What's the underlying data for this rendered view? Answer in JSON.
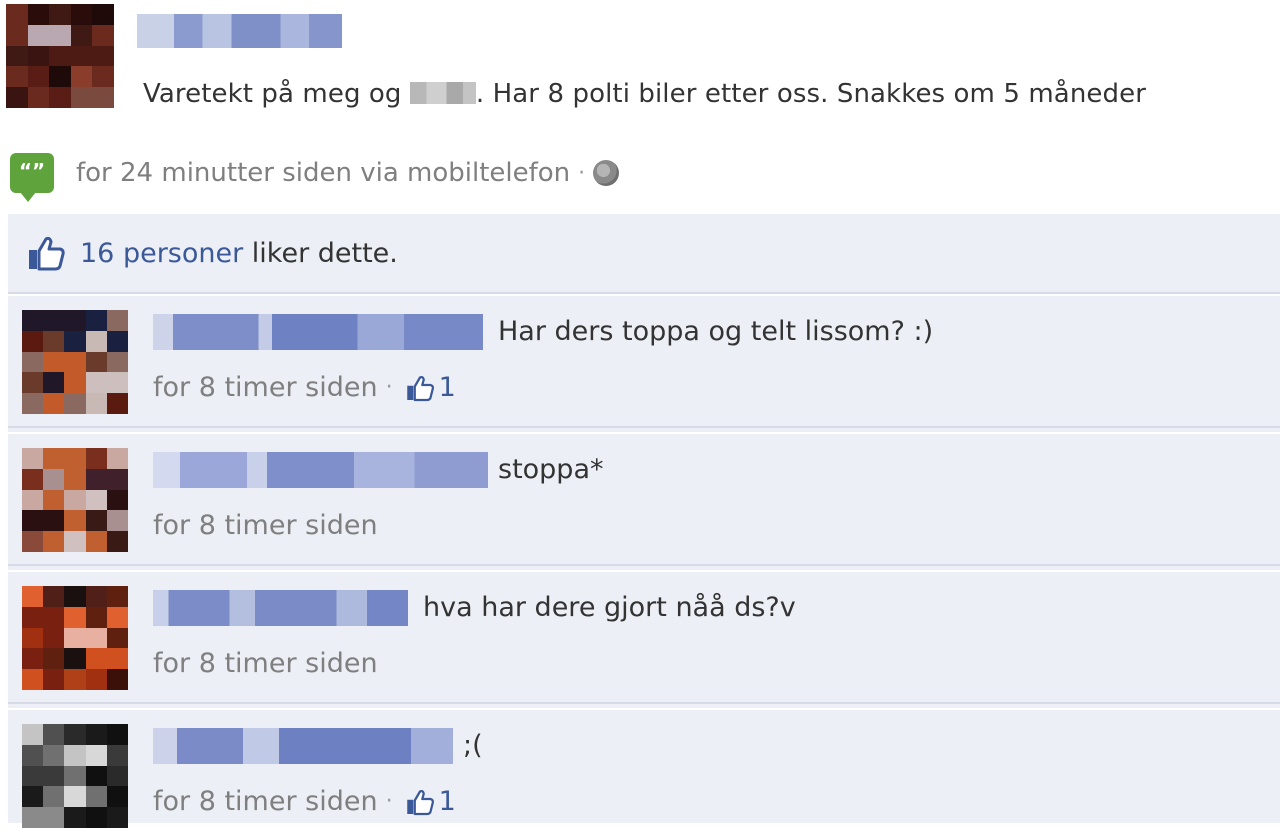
{
  "post": {
    "text_before": "Varetekt på meg og ",
    "text_after": ". Har 8 polti biler etter oss. Snakkes om 5 måneder",
    "time": "for 24 minutter siden via mobiltelefon",
    "separator": "·",
    "mobile_icon_glyph": "“”"
  },
  "likes": {
    "link": "16 personer",
    "rest": " liker dette."
  },
  "comments": [
    {
      "text": "Har ders toppa og telt lissom? :)",
      "time": "for 8 timer siden",
      "separator": "·",
      "like_count": "1"
    },
    {
      "text": "stoppa*",
      "time": "for 8 timer siden"
    },
    {
      "text": "hva har dere gjort nåå ds?v",
      "time": "for 8 timer siden"
    },
    {
      "text": ";(",
      "time": "for 8 timer siden",
      "separator": "·",
      "like_count": "1"
    }
  ],
  "icons": {
    "mobile": "speech-bubble-icon",
    "globe": "globe-icon",
    "like": "thumbs-up-icon"
  },
  "colors": {
    "link": "#3b5998",
    "feedback_bg": "#eceff5",
    "mobile_icon": "#5fa33d",
    "muted_text": "#7f7f7f"
  }
}
